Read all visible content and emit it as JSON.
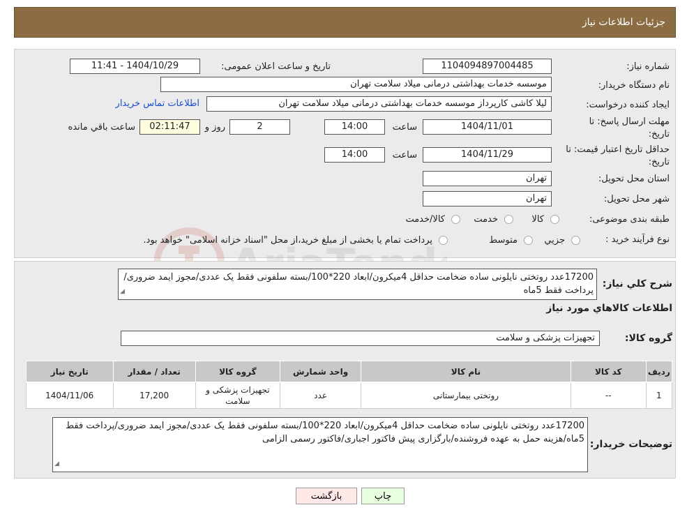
{
  "header": {
    "title": "جزئیات اطلاعات نیاز"
  },
  "fields": {
    "need_number_label": "شماره نیاز:",
    "need_number": "1104094897004485",
    "announce_label": "تاریخ و ساعت اعلان عمومی:",
    "announce_value": "1404/10/29 - 11:41",
    "buyer_org_label": "نام دستگاه خریدار:",
    "buyer_org": "موسسه خدمات بهداشتی درمانی میلاد سلامت تهران",
    "creator_label": "ایجاد کننده درخواست:",
    "creator": "لیلا کاشی کارپرداز موسسه خدمات بهداشتی درمانی میلاد سلامت تهران",
    "contact_link": "اطلاعات تماس خریدار",
    "deadline_label": "مهلت ارسال پاسخ: تا تاریخ:",
    "deadline_date": "1404/11/01",
    "time_label": "ساعت",
    "deadline_time": "14:00",
    "days_value": "2",
    "days_label": "روز و",
    "remaining_time": "02:11:47",
    "remaining_label": "ساعت باقي مانده",
    "price_validity_label": "حداقل تاريخ اعتبار قيمت: تا تاریخ:",
    "price_validity_date": "1404/11/29",
    "price_validity_time": "14:00",
    "province_label": "استان محل تحویل:",
    "province": "تهران",
    "city_label": "شهر محل تحویل:",
    "city": "تهران",
    "category_label": "طبقه بندی موضوعی:",
    "category_options": [
      "کالا",
      "خدمت",
      "کالا/خدمت"
    ],
    "process_label": "نوع فرآیند خرید :",
    "process_options": [
      "جزیي",
      "متوسط"
    ],
    "process_note": "پرداخت تمام یا بخشی از مبلغ خرید،از محل \"اسناد خزانه اسلامی\" خواهد بود."
  },
  "summary": {
    "label": "شرح کلي نياز:",
    "text": "17200عدد روتختی نایلونی ساده ضخامت حداقل 4میکرون/ابعاد 220*100/بسته سلفونی فقط یک عددی/مجوز ایمد ضروری/پرداخت فقط 5ماه",
    "goods_info_title": "اطلاعات کالاهاي مورد نياز",
    "goods_group_label": "گروه کالا:",
    "goods_group": "تجهیزات پزشکی و سلامت"
  },
  "table": {
    "headers": [
      "ردیف",
      "کد کالا",
      "نام کالا",
      "واحد شمارش",
      "گروه کالا",
      "تعداد / مقدار",
      "تاریخ نیاز"
    ],
    "rows": [
      [
        "1",
        "--",
        "روتختی بیمارستانی",
        "عدد",
        "تجهیزات پزشکی و سلامت",
        "17,200",
        "1404/11/06"
      ]
    ]
  },
  "buyer_notes": {
    "label": "توضیحات خریدار:",
    "text": "17200عدد روتختی نایلونی ساده ضخامت حداقل 4میکرون/ابعاد 220*100/بسته سلفونی فقط یک عددی/مجوز ایمد ضروری/پرداخت فقط 5ماه/هزینه حمل به عهده فروشنده/بارگزاری پیش فاکتور اجباری/فاکتور رسمی الزامی"
  },
  "buttons": {
    "print": "چاپ",
    "back": "بازگشت"
  },
  "colors": {
    "header_bg": "#8c6d43",
    "link": "#1a4fcc",
    "timer_bg": "#fffde0",
    "back_bg": "#ffe8e8",
    "print_bg": "#e8ffe0"
  }
}
